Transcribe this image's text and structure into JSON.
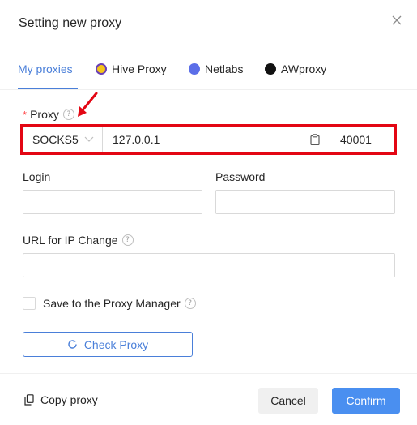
{
  "dialog": {
    "title": "Setting new proxy",
    "close_icon": "close-icon"
  },
  "tabs": [
    {
      "label": "My proxies",
      "active": true
    },
    {
      "label": "Hive Proxy",
      "icon": "hive-proxy-icon",
      "icon_color": "#f5c518"
    },
    {
      "label": "Netlabs",
      "icon": "netlabs-icon",
      "icon_color": "#5b6ee8"
    },
    {
      "label": "AWproxy",
      "icon": "awproxy-icon",
      "icon_color": "#111111"
    }
  ],
  "proxy": {
    "label": "Proxy",
    "required_mark": "*",
    "help_icon": "?",
    "protocol": "SOCKS5",
    "host": "127.0.0.1",
    "port": "40001"
  },
  "login": {
    "label": "Login",
    "value": ""
  },
  "password": {
    "label": "Password",
    "value": ""
  },
  "url_change": {
    "label": "URL for IP Change",
    "help_icon": "?",
    "value": ""
  },
  "save_checkbox": {
    "label": "Save to the Proxy Manager",
    "help_icon": "?",
    "checked": false
  },
  "check_button": {
    "label": "Check Proxy"
  },
  "footer": {
    "copy_label": "Copy proxy",
    "cancel_label": "Cancel",
    "confirm_label": "Confirm"
  },
  "colors": {
    "accent": "#4a7fd9",
    "highlight": "#e30613",
    "confirm": "#4a8ff0"
  }
}
